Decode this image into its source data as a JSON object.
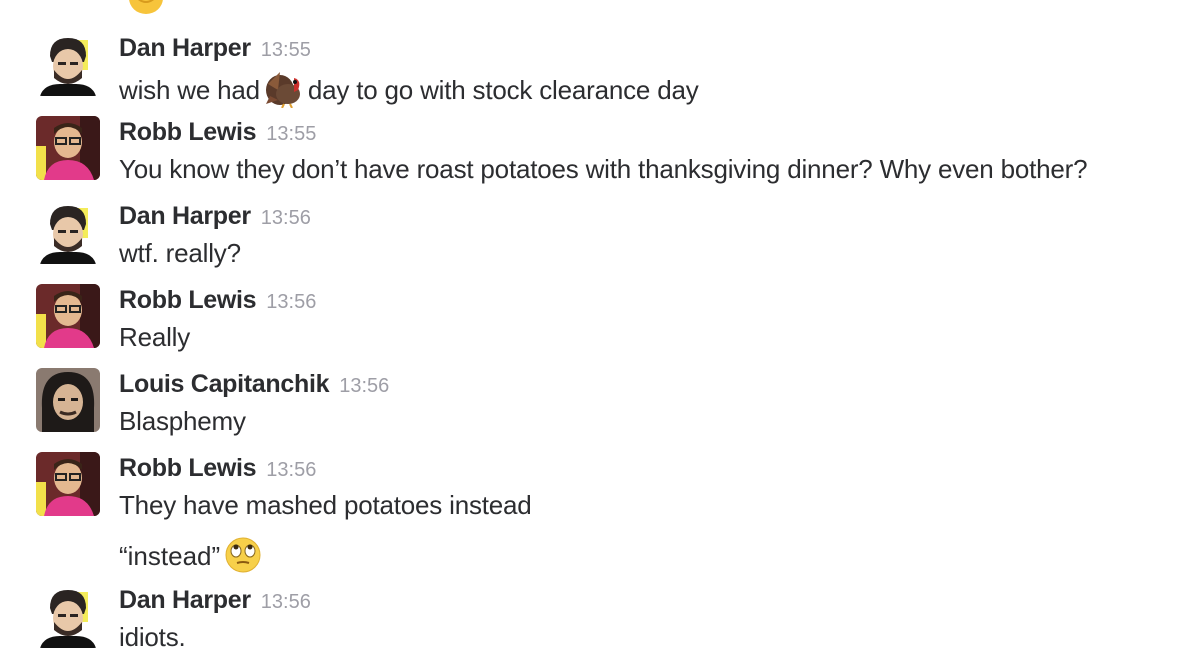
{
  "messages": [
    {
      "author": "Dan Harper",
      "time": "13:55",
      "text_before": "wish we had",
      "emoji": "turkey-emoji",
      "text_after": "day to go with stock clearance day"
    },
    {
      "author": "Robb Lewis",
      "time": "13:55",
      "text": "You know they don’t have roast potatoes with thanksgiving dinner? Why even bother?"
    },
    {
      "author": "Dan Harper",
      "time": "13:56",
      "text": "wtf. really?"
    },
    {
      "author": "Robb Lewis",
      "time": "13:56",
      "text": "Really"
    },
    {
      "author": "Louis Capitanchik",
      "time": "13:56",
      "text": "Blasphemy"
    },
    {
      "author": "Robb Lewis",
      "time": "13:56",
      "text": "They have mashed potatoes instead",
      "followup": "“instead”",
      "followup_emoji": "eye-roll-emoji"
    },
    {
      "author": "Dan Harper",
      "time": "13:56",
      "text": "idiots."
    }
  ],
  "icons": {
    "top_partial": "thumbs-up-emoji",
    "turkey": "turkey-emoji",
    "eye_roll": "eye-roll-emoji"
  },
  "colors": {
    "author": "#2c2d30",
    "timestamp": "#9e9ea6",
    "text": "#2c2d30",
    "background": "#ffffff"
  }
}
